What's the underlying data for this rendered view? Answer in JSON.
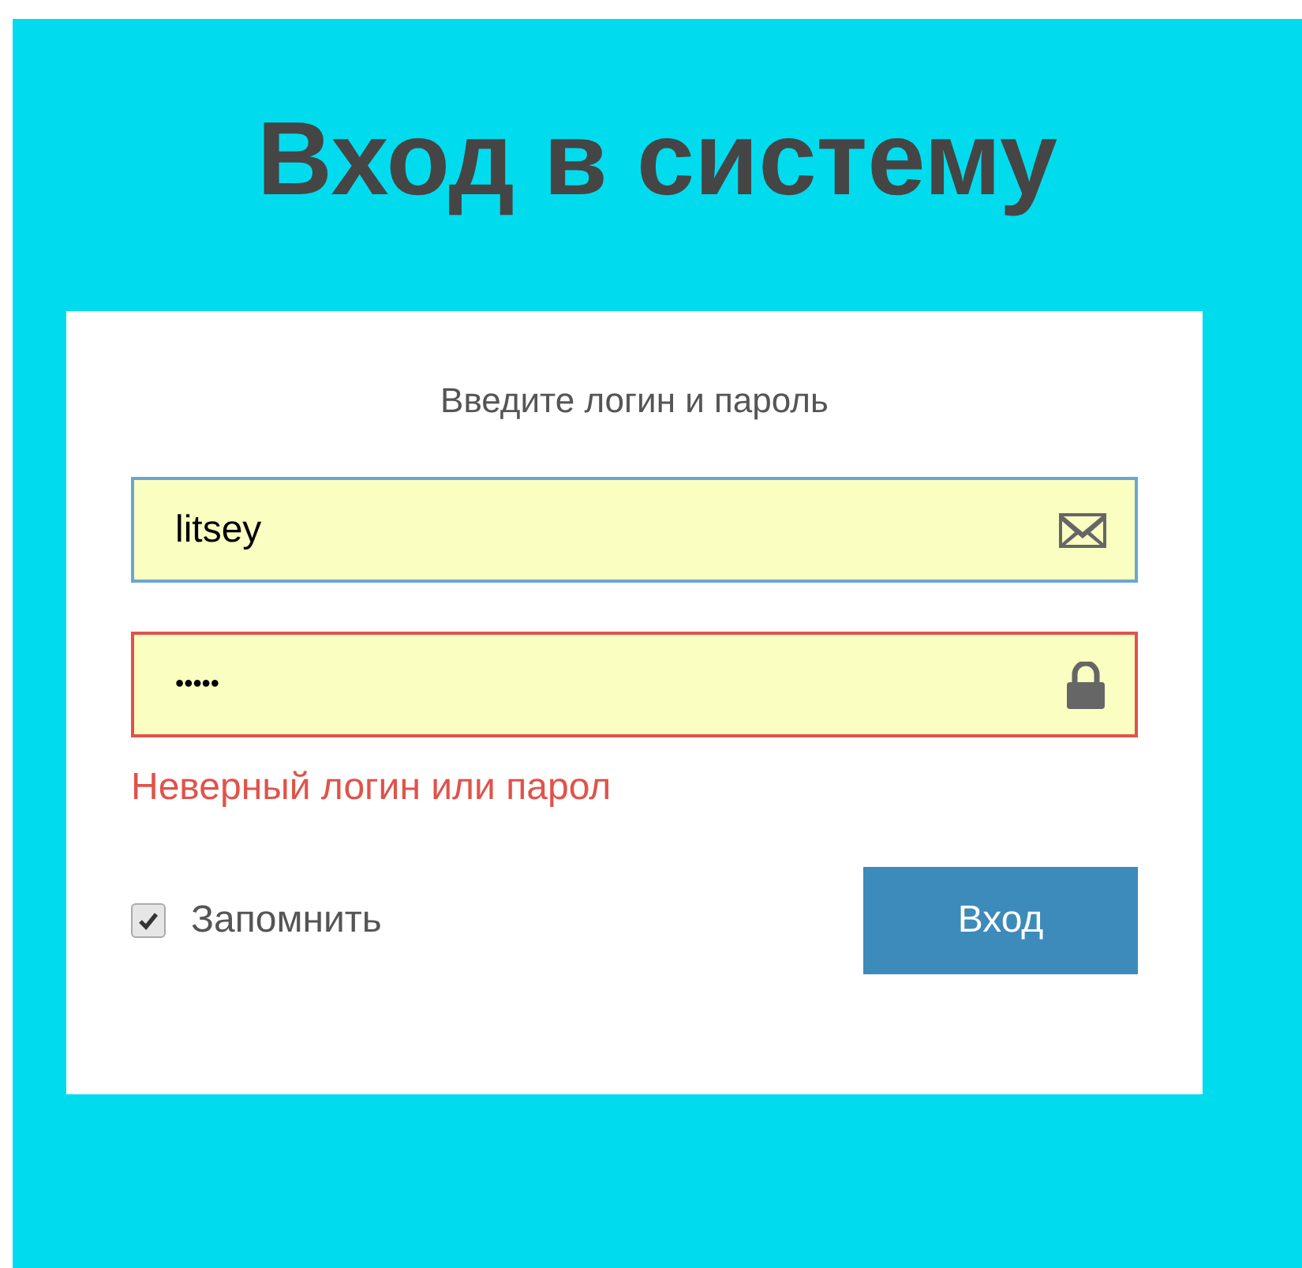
{
  "title": "Вход в систему",
  "form": {
    "prompt": "Введите логин и пароль",
    "fields": [
      {
        "kind": "login",
        "value": "litsey",
        "error": false
      },
      {
        "kind": "password",
        "value": "•••••",
        "error": true
      }
    ],
    "error_message": "Неверный логин или парол",
    "remember": {
      "label": "Запомнить",
      "checked": true
    },
    "submit": "Вход"
  }
}
